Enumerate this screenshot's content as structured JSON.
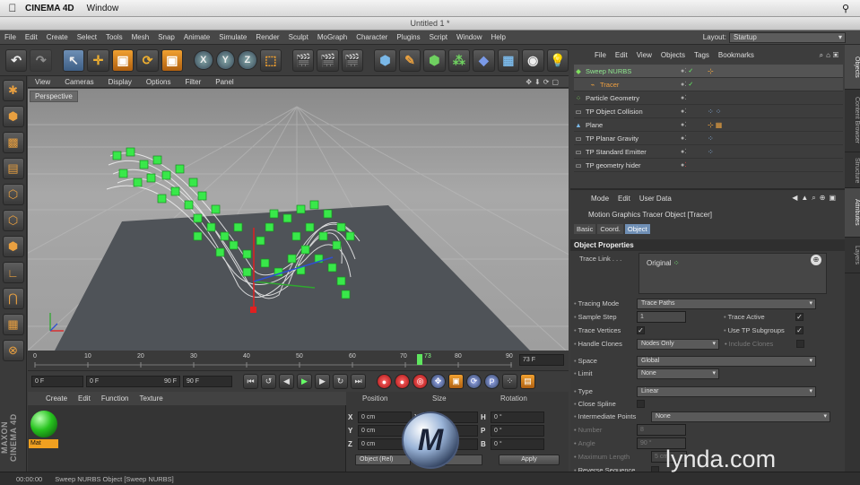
{
  "mac": {
    "app": "CINEMA 4D",
    "menu": "Window"
  },
  "window_title": "Untitled 1 *",
  "menus": [
    "File",
    "Edit",
    "Create",
    "Select",
    "Tools",
    "Mesh",
    "Snap",
    "Animate",
    "Simulate",
    "Render",
    "Sculpt",
    "MoGraph",
    "Character",
    "Plugins",
    "Script",
    "Window",
    "Help"
  ],
  "layout": {
    "label": "Layout:",
    "value": "Startup"
  },
  "viewport": {
    "menus": [
      "View",
      "Cameras",
      "Display",
      "Options",
      "Filter",
      "Panel"
    ],
    "label": "Perspective"
  },
  "timeline": {
    "ticks": [
      "0",
      "10",
      "20",
      "30",
      "40",
      "50",
      "60",
      "70",
      "80",
      "90"
    ],
    "current": "73",
    "end_field": "73 F"
  },
  "controls": {
    "start": "0 F",
    "range_start": "0 F",
    "range_end": "90 F",
    "end": "90 F"
  },
  "materials": {
    "menus": [
      "Create",
      "Edit",
      "Function",
      "Texture"
    ],
    "mat_name": "Mat",
    "brand": "MAXON CINEMA 4D"
  },
  "coords": {
    "headers": [
      "Position",
      "Size",
      "Rotation"
    ],
    "axes": [
      "X",
      "Y",
      "Z"
    ],
    "rot_axes": [
      "H",
      "P",
      "B"
    ],
    "pos": [
      "0 cm",
      "0 cm",
      "0 cm"
    ],
    "size": [
      "74 cm",
      "0 cm",
      "0 cm"
    ],
    "rot": [
      "0 °",
      "0 °",
      "0 °"
    ],
    "mode": "Object (Rel)",
    "size_mode": "Size",
    "apply": "Apply"
  },
  "status": {
    "time": "00:00:00",
    "text": "Sweep NURBS Object [Sweep NURBS]"
  },
  "objects": {
    "menus": [
      "File",
      "Edit",
      "View",
      "Objects",
      "Tags",
      "Bookmarks"
    ],
    "items": [
      {
        "name": "Sweep NURBS",
        "indent": 0,
        "checks": "✓",
        "tags": "⊹"
      },
      {
        "name": "Tracer",
        "indent": 1,
        "checks": "✓",
        "tags": ""
      },
      {
        "name": "Particle Geometry",
        "indent": 0,
        "checks": "",
        "tags": ""
      },
      {
        "name": "TP Object Collision",
        "indent": 0,
        "checks": "",
        "tags": "⁘⁘"
      },
      {
        "name": "Plane",
        "indent": 0,
        "checks": "",
        "tags": "⊹▦"
      },
      {
        "name": "TP Planar Gravity",
        "indent": 0,
        "checks": "",
        "tags": "⁘"
      },
      {
        "name": "TP Standard Emitter",
        "indent": 0,
        "checks": "",
        "tags": "⁘"
      },
      {
        "name": "TP geometry hider",
        "indent": 0,
        "checks": "",
        "tags": ""
      }
    ]
  },
  "attributes": {
    "menus": [
      "Mode",
      "Edit",
      "User Data"
    ],
    "object": "Motion Graphics Tracer Object [Tracer]",
    "tabs": [
      "Basic",
      "Coord.",
      "Object"
    ],
    "section": "Object Properties",
    "trace_link": "Trace Link . . .",
    "trace_item": "Original",
    "props": [
      {
        "label": "Tracing Mode",
        "value": "Trace Paths",
        "type": "dd"
      },
      {
        "label": "Sample Step",
        "value": "1",
        "type": "num",
        "right_label": "Trace Active",
        "right": "✓"
      },
      {
        "label": "Trace Vertices",
        "value": "✓",
        "type": "chk",
        "right_label": "Use TP Subgroups",
        "right": "✓"
      },
      {
        "label": "Handle Clones",
        "value": "Nodes Only",
        "type": "dd2",
        "right_label": "Include Clones",
        "right": ""
      },
      {
        "label": "Space",
        "value": "Global",
        "type": "dd"
      },
      {
        "label": "Limit",
        "value": "None",
        "type": "dd2"
      },
      {
        "label": "Type",
        "value": "Linear",
        "type": "dd"
      },
      {
        "label": "Close Spline",
        "value": "",
        "type": "chk"
      },
      {
        "label": "Intermediate Points",
        "value": "None",
        "type": "dd"
      },
      {
        "label": "Number",
        "value": "8",
        "type": "num",
        "dim": true
      },
      {
        "label": "Angle",
        "value": "90 °",
        "type": "num",
        "dim": true
      },
      {
        "label": "Maximum Length",
        "value": "5 cm",
        "type": "num",
        "dim": true
      },
      {
        "label": "Reverse Sequence",
        "value": "",
        "type": "chk"
      }
    ]
  },
  "side_tabs": [
    "Objects",
    "Content Browser",
    "Structure",
    "Attributes",
    "Layers"
  ],
  "watermark": "lynda.com"
}
